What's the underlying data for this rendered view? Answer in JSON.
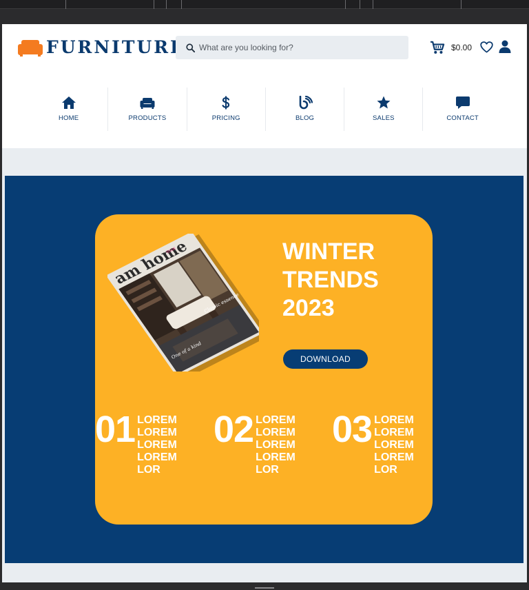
{
  "header": {
    "logo_text": "FURNITURE",
    "search_placeholder": "What are you looking for?",
    "cart_total": "$0.00"
  },
  "nav": {
    "items": [
      {
        "label": "HOME",
        "icon": "home-icon"
      },
      {
        "label": "PRODUCTS",
        "icon": "sofa-icon"
      },
      {
        "label": "PRICING",
        "icon": "dollar-icon"
      },
      {
        "label": "BLOG",
        "icon": "blog-icon"
      },
      {
        "label": "SALES",
        "icon": "star-icon"
      },
      {
        "label": "CONTACT",
        "icon": "chat-icon"
      }
    ]
  },
  "hero": {
    "title_lines": [
      "WINTER",
      "TRENDS",
      "2023"
    ],
    "download_label": "DOWNLOAD",
    "magazine": {
      "title": "am home",
      "tagline_1": "Classic essence",
      "tagline_2": "One of a kind"
    },
    "stats": [
      {
        "number": "01",
        "lines": [
          "LOREM",
          "LOREM",
          "LOREM",
          "LOREM",
          "LOR"
        ]
      },
      {
        "number": "02",
        "lines": [
          "LOREM",
          "LOREM",
          "LOREM",
          "LOREM",
          "LOR"
        ]
      },
      {
        "number": "03",
        "lines": [
          "LOREM",
          "LOREM",
          "LOREM",
          "LOREM",
          "LOR"
        ]
      }
    ]
  },
  "colors": {
    "brand_navy": "#073d74",
    "brand_orange": "#fdb125",
    "logo_orange": "#f47b20",
    "page_bg": "#e9edf1"
  }
}
